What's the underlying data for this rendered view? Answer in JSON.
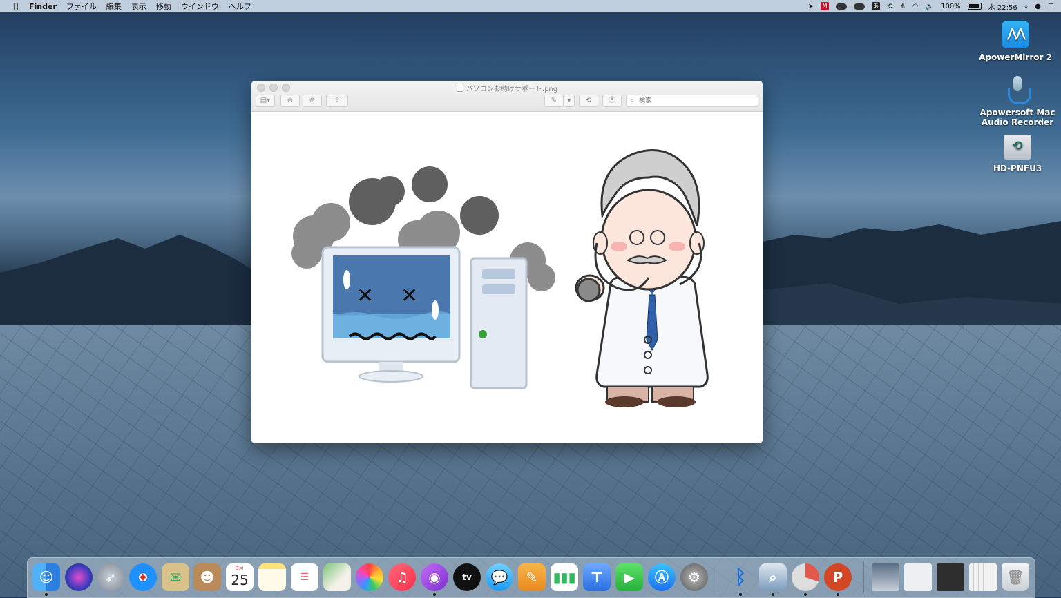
{
  "menubar": {
    "apple": "",
    "app_name": "Finder",
    "menus": [
      "ファイル",
      "編集",
      "表示",
      "移動",
      "ウインドウ",
      "ヘルプ"
    ],
    "status": {
      "location_icon": "location-arrow-icon",
      "mcafee_label": "M",
      "ime_label": "あ",
      "battery": "100%",
      "clock": "水 22:56"
    }
  },
  "desktop_icons": [
    {
      "label": "ApowerMirror 2"
    },
    {
      "label": "Apowersoft Mac Audio Recorder"
    },
    {
      "label": "HD-PNFU3"
    }
  ],
  "preview": {
    "title": "パソコンお助けサポート.png",
    "search_placeholder": "検索"
  },
  "calendar": {
    "month": "3月",
    "day": "25"
  },
  "dock_apps": [
    {
      "name": "finder",
      "color": "#2a8ff0"
    },
    {
      "name": "siri",
      "color": "#3b3b8f"
    },
    {
      "name": "launchpad",
      "color": "#9aa4b0"
    },
    {
      "name": "safari",
      "color": "#1e90ff"
    },
    {
      "name": "mail",
      "color": "#d9c28a"
    },
    {
      "name": "contacts",
      "color": "#b98b5a"
    },
    {
      "name": "calendar",
      "color": "#ffffff"
    },
    {
      "name": "notes",
      "color": "#fbe27a"
    },
    {
      "name": "reminders",
      "color": "#ffffff"
    },
    {
      "name": "maps",
      "color": "#7cc576"
    },
    {
      "name": "photos",
      "color": "#ffffff"
    },
    {
      "name": "music",
      "color": "#fa3b58"
    },
    {
      "name": "podcasts",
      "color": "#9b4be0"
    },
    {
      "name": "apple-tv",
      "color": "#111111"
    },
    {
      "name": "messages",
      "color": "#3fb5f5"
    },
    {
      "name": "pages",
      "color": "#f0a030"
    },
    {
      "name": "numbers",
      "color": "#2fb95a"
    },
    {
      "name": "keynote",
      "color": "#3d7ff0"
    },
    {
      "name": "facetime",
      "color": "#35c34d"
    },
    {
      "name": "app-store",
      "color": "#1a8af5"
    },
    {
      "name": "system-preferences",
      "color": "#7a7a7a"
    },
    {
      "name": "bluetooth-file-exchange",
      "color": "#1d6fd6"
    },
    {
      "name": "preview",
      "color": "#7a9bbf"
    },
    {
      "name": "istat-menus",
      "color": "#e4574c"
    },
    {
      "name": "powerpoint",
      "color": "#d24726"
    },
    {
      "name": "screenshot-stack-1",
      "color": "#dde3ea"
    },
    {
      "name": "screenshot-stack-2",
      "color": "#eef0f3"
    },
    {
      "name": "screenshot-stack-3",
      "color": "#2d2d2d"
    },
    {
      "name": "screenshot-stack-4",
      "color": "#f2f2f2"
    },
    {
      "name": "trash",
      "color": "#d8dde3"
    }
  ]
}
